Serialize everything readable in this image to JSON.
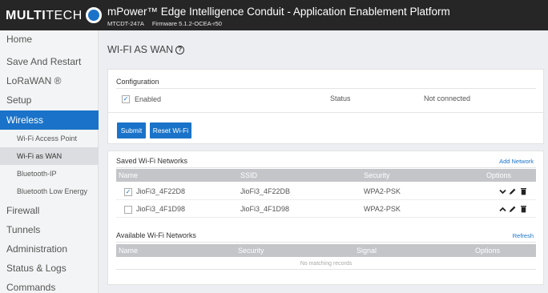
{
  "header": {
    "logo_bold": "MULTI",
    "logo_light": "TECH",
    "app_title": "mPower™ Edge Intelligence Conduit - Application Enablement Platform",
    "model": "MTCDT-247A",
    "firmware": "Firmware  5.1.2-OCEA-r50"
  },
  "sidebar": {
    "items": [
      {
        "label": "Home"
      },
      {
        "label": "Save And Restart"
      },
      {
        "label": "LoRaWAN ®"
      },
      {
        "label": "Setup"
      },
      {
        "label": "Wireless"
      },
      {
        "label": "Wi-Fi Access Point"
      },
      {
        "label": "Wi-Fi as WAN"
      },
      {
        "label": "Bluetooth-IP"
      },
      {
        "label": "Bluetooth Low Energy"
      },
      {
        "label": "Firewall"
      },
      {
        "label": "Tunnels"
      },
      {
        "label": "Administration"
      },
      {
        "label": "Status & Logs"
      },
      {
        "label": "Commands"
      }
    ]
  },
  "page": {
    "title": "WI-FI AS WAN",
    "help_icon": "?"
  },
  "configuration": {
    "label": "Configuration",
    "enabled_label": "Enabled",
    "enabled": true,
    "status_label": "Status",
    "status_value": "Not connected"
  },
  "buttons": {
    "submit": "Submit",
    "reset": "Reset Wi-Fi"
  },
  "saved_networks": {
    "label": "Saved Wi-Fi Networks",
    "add_link": "Add Network",
    "columns": {
      "name": "Name",
      "ssid": "SSID",
      "security": "Security",
      "options": "Options"
    },
    "rows": [
      {
        "name": "JioFi3_4F22D8",
        "ssid": "JioFi3_4F22DB",
        "security": "WPA2-PSK",
        "checked": true,
        "arrow": "down"
      },
      {
        "name": "JioFi3_4F1D98",
        "ssid": "JioFi3_4F1D98",
        "security": "WPA2-PSK",
        "checked": false,
        "arrow": "up"
      }
    ]
  },
  "available_networks": {
    "label": "Available Wi-Fi Networks",
    "refresh_link": "Refresh",
    "columns": {
      "name": "Name",
      "security": "Security",
      "signal": "Signal",
      "options": "Options"
    },
    "empty_text": "No matching records"
  },
  "colors": {
    "accent": "#1a73c9",
    "header_bg": "#262626",
    "table_header": "#c3c5c9"
  },
  "icons": {
    "check": "✓",
    "chevron_down": "⌄",
    "chevron_up": "⌃"
  }
}
